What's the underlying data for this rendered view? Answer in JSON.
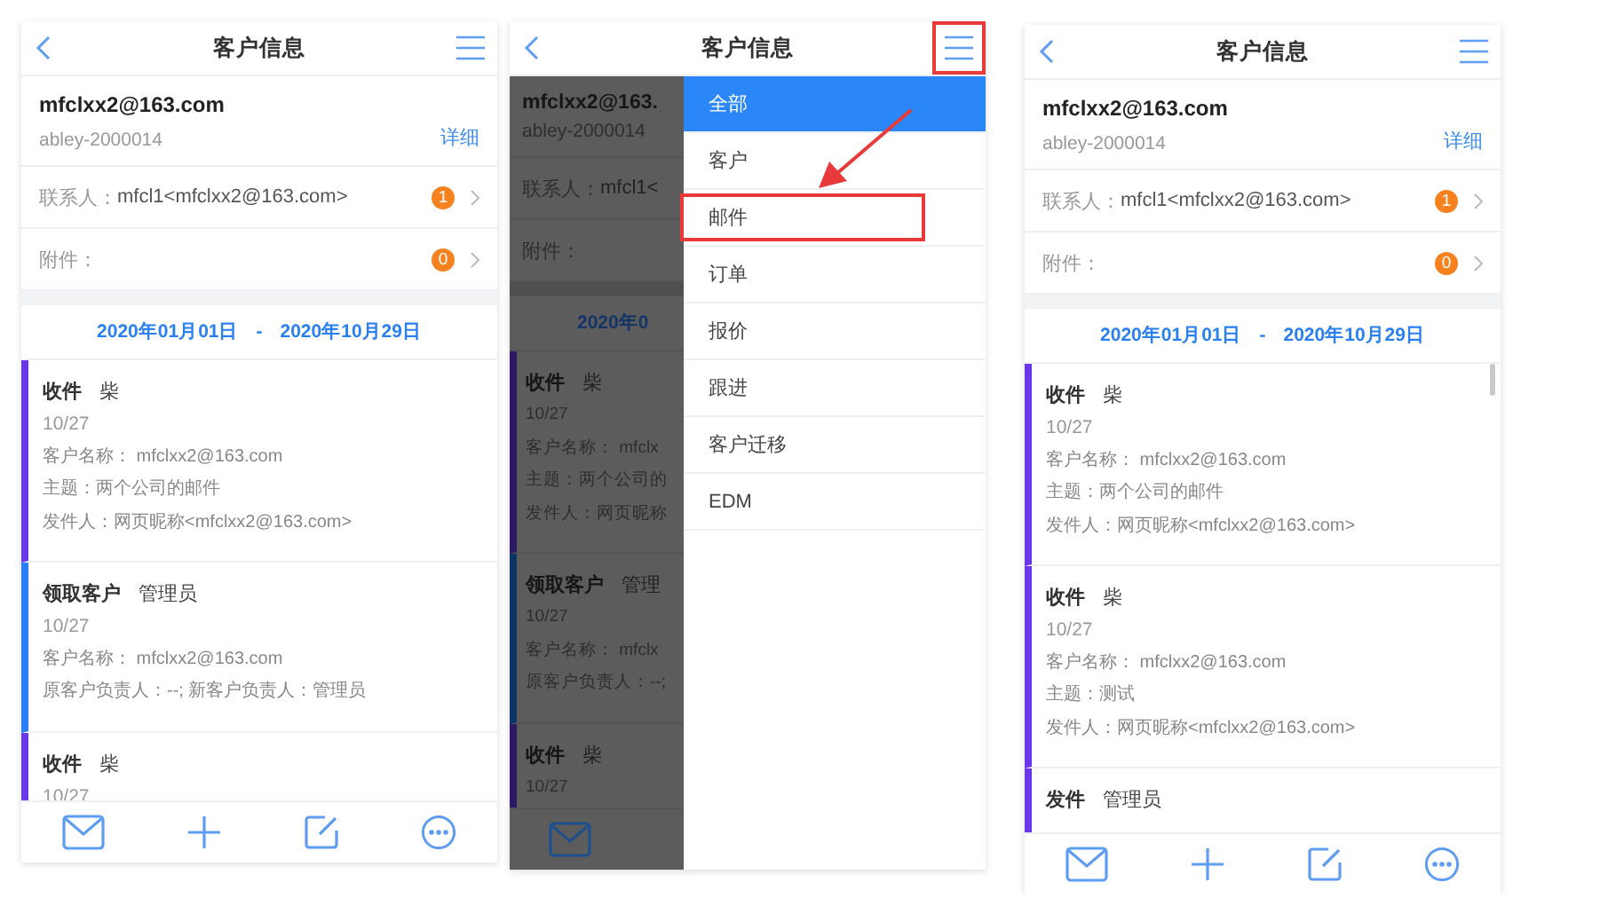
{
  "phones": [
    {
      "kind": "detail",
      "header": {
        "title": "客户信息",
        "menu_highlighted": false
      },
      "customer": {
        "email": "mfclxx2@163.com",
        "id": "abley-2000014",
        "detail_link": "详细"
      },
      "contact": {
        "label": "联系人：",
        "value": "mfcl1<mfclxx2@163.com>",
        "count": "1"
      },
      "attachment": {
        "label": "附件：",
        "count": "0"
      },
      "date_range": {
        "start": "2020年01月01日",
        "separator": "-",
        "end": "2020年10月29日"
      },
      "events": [
        {
          "action": "收件",
          "person": "柴",
          "color": "#6a38e6",
          "date": "10/27",
          "lines": [
            "客户名称：  mfclxx2@163.com",
            "主题：两个公司的邮件",
            "发件人：网页昵称<mfclxx2@163.com>"
          ]
        },
        {
          "action": "领取客户",
          "person": "管理员",
          "color": "#2a7ef5",
          "date": "10/27",
          "lines": [
            "客户名称：  mfclxx2@163.com",
            "原客户负责人：--; 新客户负责人：管理员"
          ]
        },
        {
          "action": "收件",
          "person": "柴",
          "color": "#6a38e6",
          "date": "10/27"
        }
      ]
    },
    {
      "kind": "menu_open",
      "header": {
        "title": "客户信息",
        "menu_highlighted": true
      },
      "background": {
        "customer": {
          "email": "mfclxx2@163.",
          "id": "abley-2000014"
        },
        "contact": {
          "label": "联系人：",
          "value": "mfcl1<"
        },
        "attachment": {
          "label": "附件："
        },
        "date_range": {
          "start": "2020年0"
        },
        "events": [
          {
            "action": "收件",
            "person": "柴",
            "color": "#2b1a63",
            "date": "10/27",
            "lines": [
              "客户名称： mfclx",
              "主题：两个公司的",
              "发件人：网页昵称"
            ]
          },
          {
            "action": "领取客户",
            "person": "管理",
            "color": "#0d3568",
            "date": "10/27",
            "lines": [
              "客户名称： mfclx",
              "原客户负责人：--;"
            ]
          },
          {
            "action": "收件",
            "person": "柴",
            "color": "#2b1a63",
            "date": "10/27"
          }
        ]
      },
      "menu": {
        "items": [
          {
            "label": "全部",
            "selected": true,
            "highlighted": false
          },
          {
            "label": "客户",
            "selected": false,
            "highlighted": false
          },
          {
            "label": "邮件",
            "selected": false,
            "highlighted": true
          },
          {
            "label": "订单",
            "selected": false,
            "highlighted": false
          },
          {
            "label": "报价",
            "selected": false,
            "highlighted": false
          },
          {
            "label": "跟进",
            "selected": false,
            "highlighted": false
          },
          {
            "label": "客户迁移",
            "selected": false,
            "highlighted": false
          },
          {
            "label": "EDM",
            "selected": false,
            "highlighted": false
          }
        ]
      },
      "annotation_arrow": true
    },
    {
      "kind": "detail",
      "header": {
        "title": "客户信息",
        "menu_highlighted": false
      },
      "customer": {
        "email": "mfclxx2@163.com",
        "id": "abley-2000014",
        "detail_link": "详细"
      },
      "contact": {
        "label": "联系人：",
        "value": "mfcl1<mfclxx2@163.com>",
        "count": "1"
      },
      "attachment": {
        "label": "附件：",
        "count": "0"
      },
      "date_range": {
        "start": "2020年01月01日",
        "separator": "-",
        "end": "2020年10月29日"
      },
      "events": [
        {
          "action": "收件",
          "person": "柴",
          "color": "#6a38e6",
          "date": "10/27",
          "lines": [
            "客户名称：  mfclxx2@163.com",
            "主题：两个公司的邮件",
            "发件人：网页昵称<mfclxx2@163.com>"
          ]
        },
        {
          "action": "收件",
          "person": "柴",
          "color": "#6a38e6",
          "date": "10/27",
          "lines": [
            "客户名称：  mfclxx2@163.com",
            "主题：测试",
            "发件人：网页昵称<mfclxx2@163.com>"
          ]
        },
        {
          "action": "发件",
          "person": "管理员",
          "color": "#6a38e6"
        }
      ],
      "scrollbar": true
    }
  ]
}
